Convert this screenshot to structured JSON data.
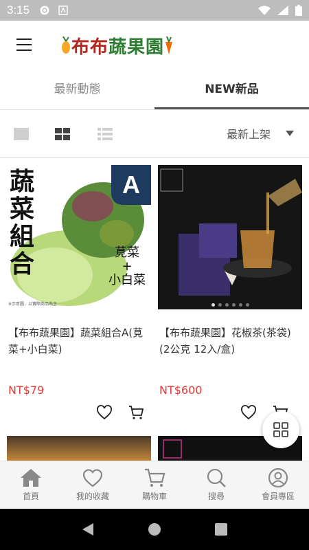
{
  "status_bar": {
    "time": "3:15"
  },
  "app": {
    "logo_text_red": "布布",
    "logo_text_green": "蔬果園",
    "menu_icon": "hamburger-icon"
  },
  "tabs": [
    {
      "label": "最新動態",
      "active": false
    },
    {
      "label": "NEW新品",
      "active": true
    }
  ],
  "toolbar": {
    "sort_label": "最新上架"
  },
  "products": [
    {
      "title": "【布布蔬果園】蔬菜組合A(莧菜+小白菜)",
      "price": "NT$79",
      "image_text": {
        "vertical": "蔬菜組合",
        "badge": "A",
        "line1": "莧菜",
        "plus": "+",
        "line2": "小白菜",
        "note": "※示意圖，以實際商品為主"
      }
    },
    {
      "title": "【布布蔬果園】花椒茶(茶袋)(2公克 12入/盒)",
      "price": "NT$600"
    }
  ],
  "bottom_nav": [
    {
      "label": "首頁",
      "icon": "home-icon"
    },
    {
      "label": "我的收藏",
      "icon": "heart-icon"
    },
    {
      "label": "購物車",
      "icon": "cart-icon"
    },
    {
      "label": "搜尋",
      "icon": "search-icon"
    },
    {
      "label": "會員專區",
      "icon": "user-icon"
    }
  ]
}
